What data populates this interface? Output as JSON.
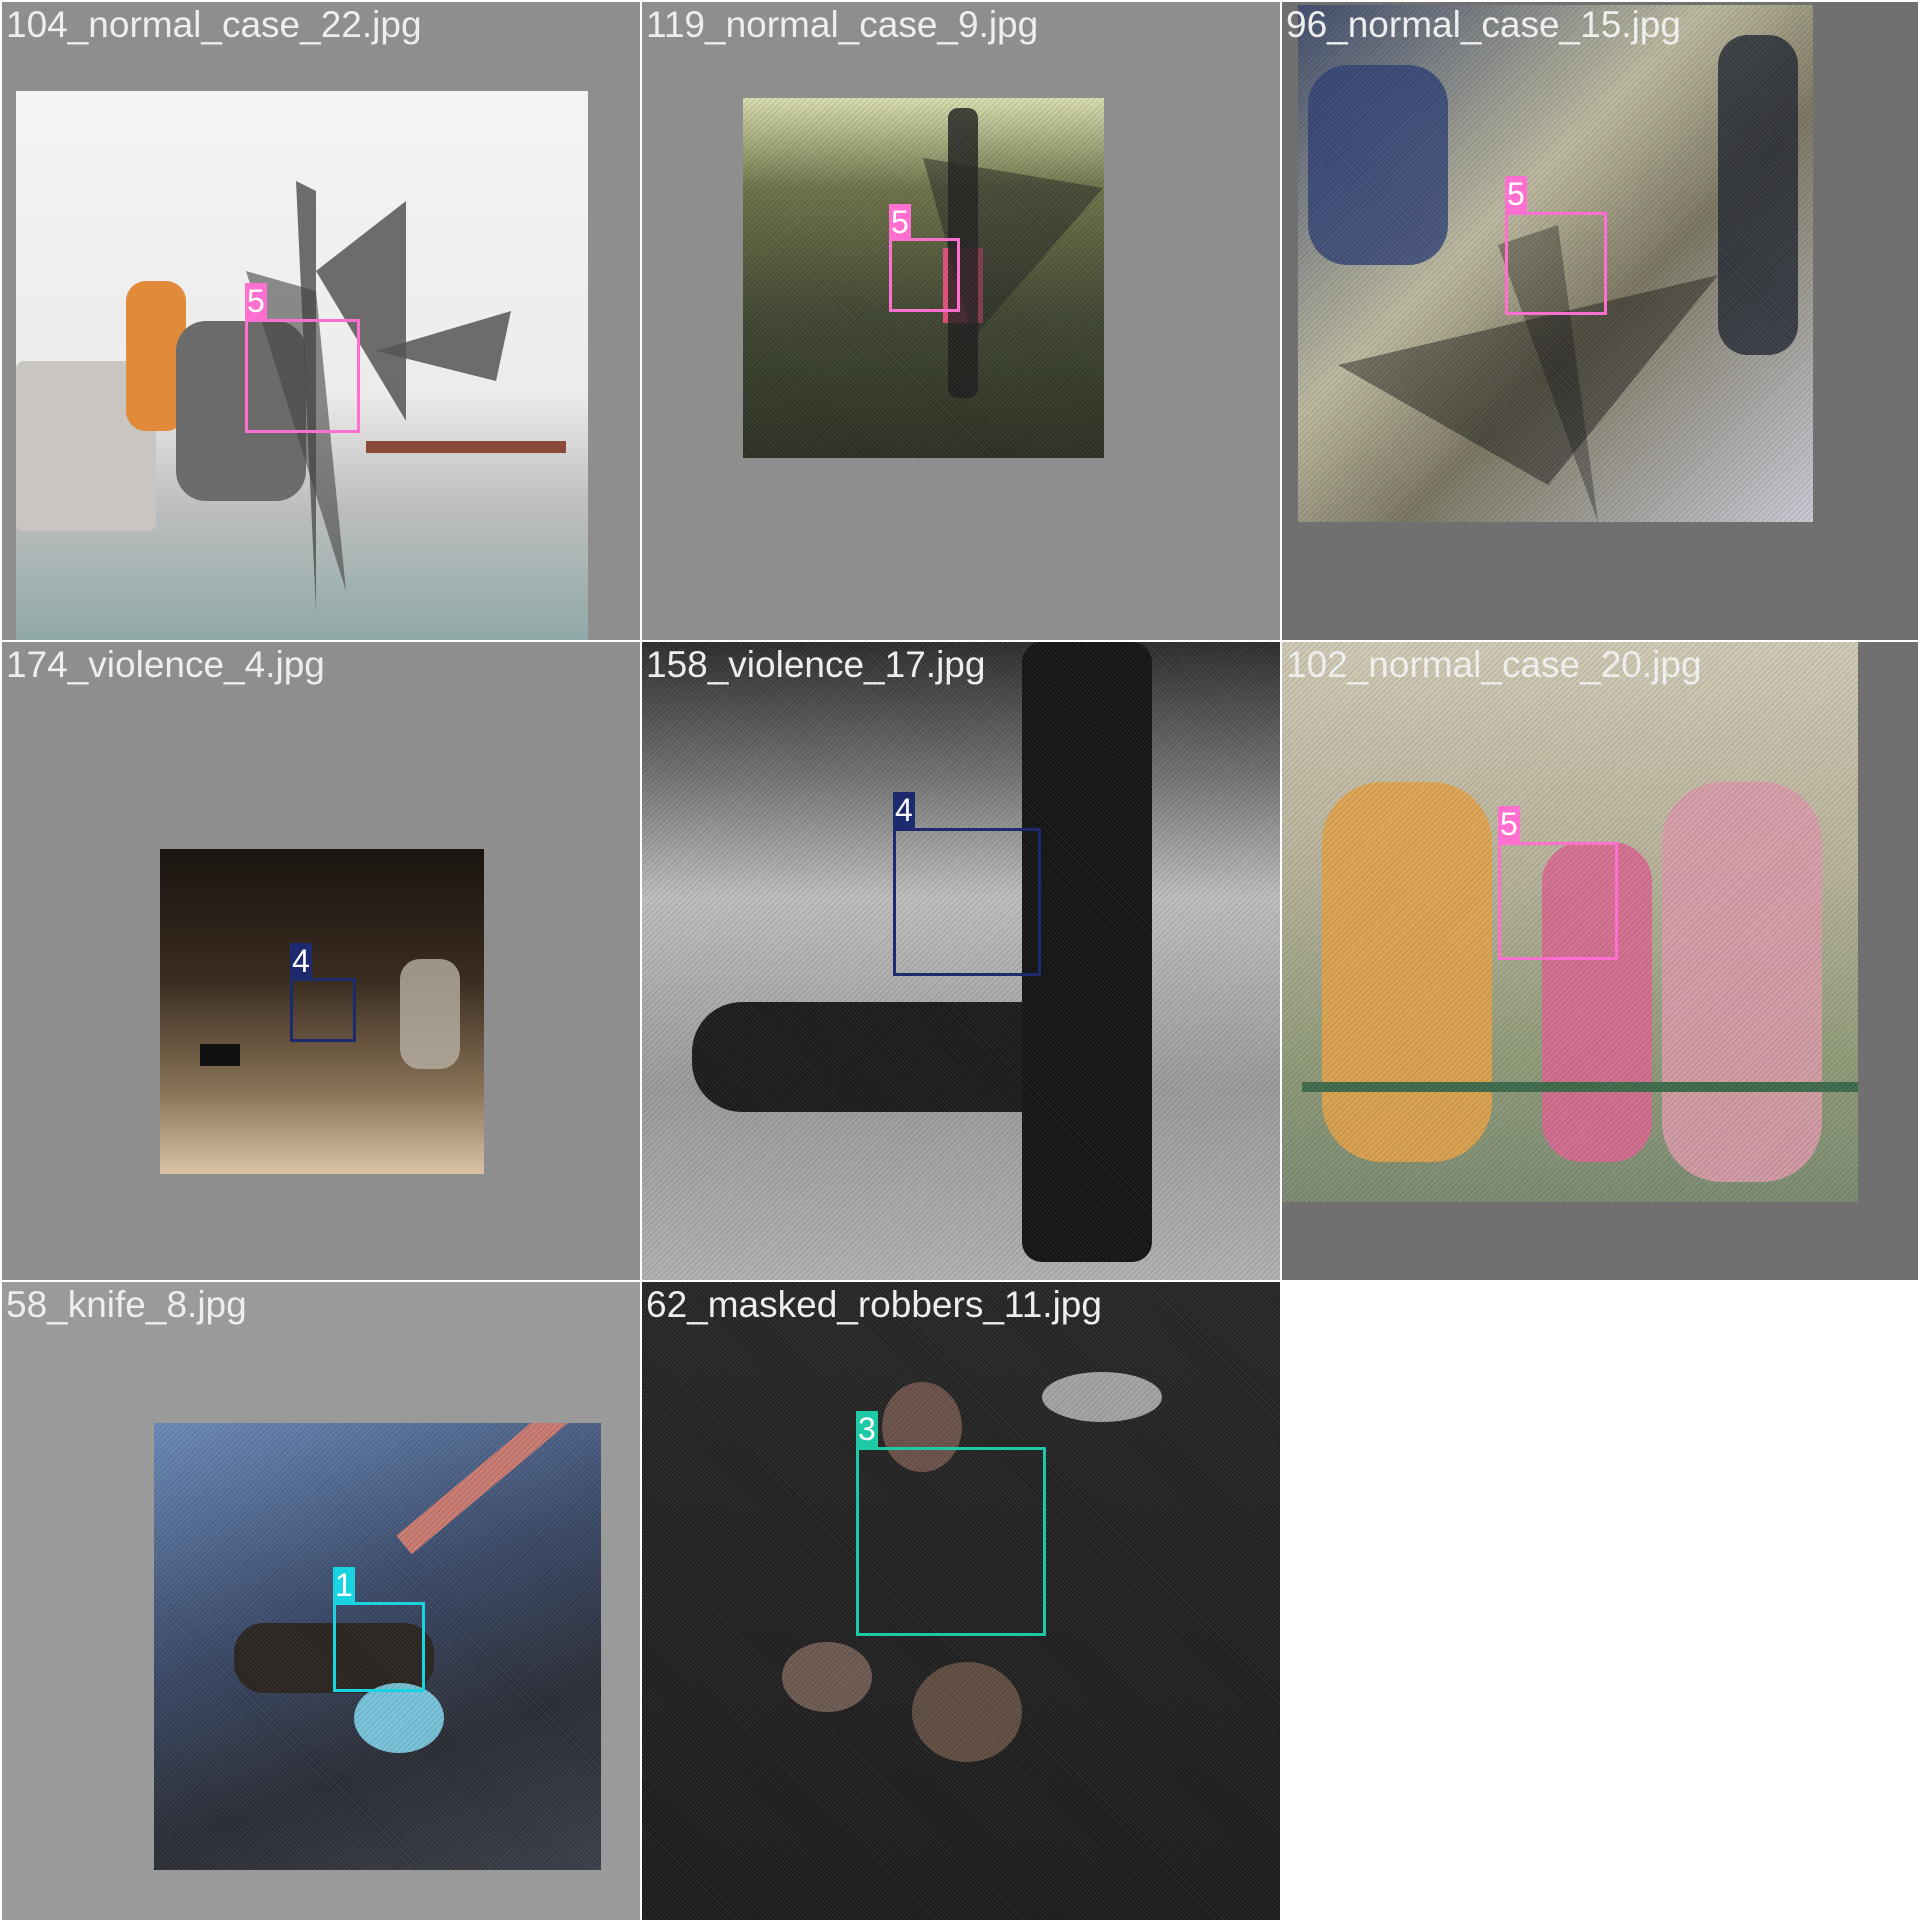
{
  "tiles": [
    {
      "filename": "104_normal_case_22.jpg",
      "label": "5",
      "color": "#ff6fd0"
    },
    {
      "filename": "119_normal_case_9.jpg",
      "label": "5",
      "color": "#ff6fd0"
    },
    {
      "filename": "96_normal_case_15.jpg",
      "label": "5",
      "color": "#ff6fd0"
    },
    {
      "filename": "174_violence_4.jpg",
      "label": "4",
      "color": "#1e2a6e"
    },
    {
      "filename": "158_violence_17.jpg",
      "label": "4",
      "color": "#1e2a6e"
    },
    {
      "filename": "102_normal_case_20.jpg",
      "label": "5",
      "color": "#ff6fd0"
    },
    {
      "filename": "58_knife_8.jpg",
      "label": "1",
      "color": "#19d4e0"
    },
    {
      "filename": "62_masked_robbers_11.jpg",
      "label": "3",
      "color": "#1ec9a8"
    }
  ]
}
